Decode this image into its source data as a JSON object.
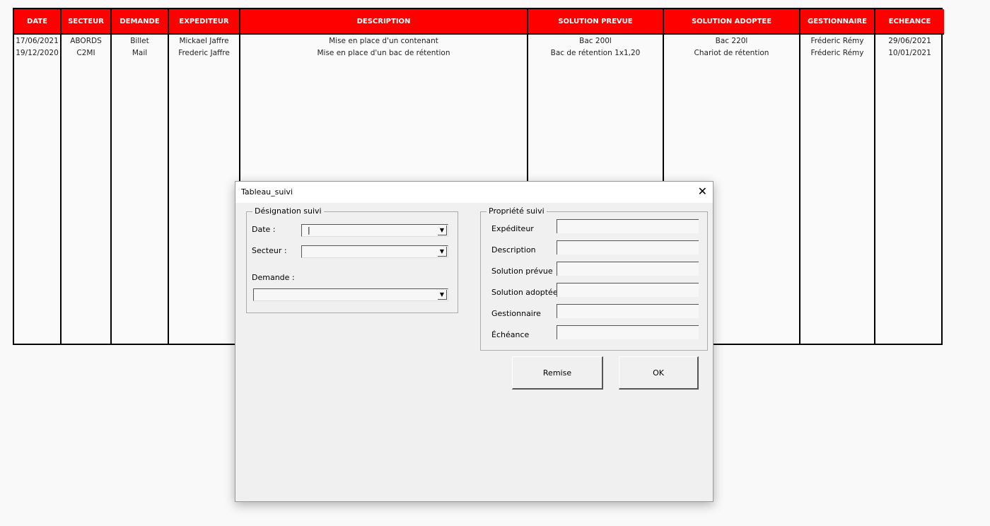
{
  "table": {
    "headers": [
      "DATE",
      "SECTEUR",
      "DEMANDE",
      "EXPEDITEUR",
      "DESCRIPTION",
      "SOLUTION  PREVUE",
      "SOLUTION ADOPTEE",
      "GESTIONNAIRE",
      "ECHEANCE"
    ],
    "rows": [
      [
        "17/06/2021",
        "ABORDS",
        "Billet",
        "Mickael Jaffre",
        "Mise en place d'un contenant",
        "Bac 200l",
        "Bac 220l",
        "Fréderic Rémy",
        "29/06/2021"
      ],
      [
        "19/12/2020",
        "C2MI",
        "Mail",
        "Frederic Jaffre",
        "Mise en place d'un bac de rétention",
        "Bac de rétention 1x1,20",
        "Chariot de rétention",
        "Fréderic Rémy",
        "10/01/2021"
      ]
    ]
  },
  "dialog": {
    "title": "Tableau_suivi",
    "left_frame": {
      "legend": "Désignation suivi",
      "date_label": "Date :",
      "date_value": "|",
      "secteur_label": "Secteur :",
      "demande_label": "Demande :"
    },
    "right_frame": {
      "legend": "Propriété suivi",
      "fields": [
        "Expéditeur",
        "Description",
        "Solution prévue",
        "Solution adoptée",
        "Gestionnaire",
        "Échéance"
      ]
    },
    "remise_label": "Remise",
    "ok_label": "OK"
  }
}
